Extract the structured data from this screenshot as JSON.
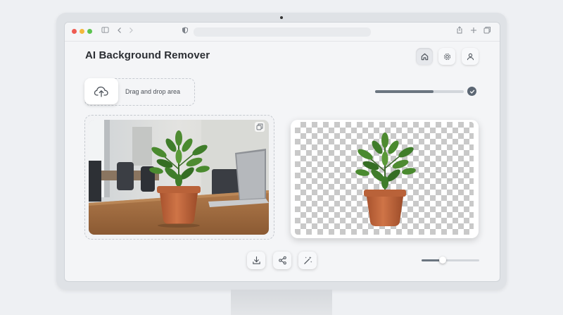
{
  "app": {
    "title": "AI Background Remover"
  },
  "icons": {
    "home": "home-icon",
    "settings": "gear-icon",
    "user": "user-icon",
    "upload": "cloud-upload-icon",
    "download": "download-icon",
    "share": "share-icon",
    "magic": "magic-wand-icon",
    "copy": "copy-icon",
    "check": "check-icon"
  },
  "upload": {
    "label": "Drag and drop area"
  },
  "progress": {
    "value": 0.66
  },
  "zoom_slider": {
    "value": 0.37
  },
  "colors": {
    "accent": "#5b6673",
    "pot": "#c1693f",
    "leaf": "#3f7d2a",
    "checker": "#c9c9c9"
  }
}
